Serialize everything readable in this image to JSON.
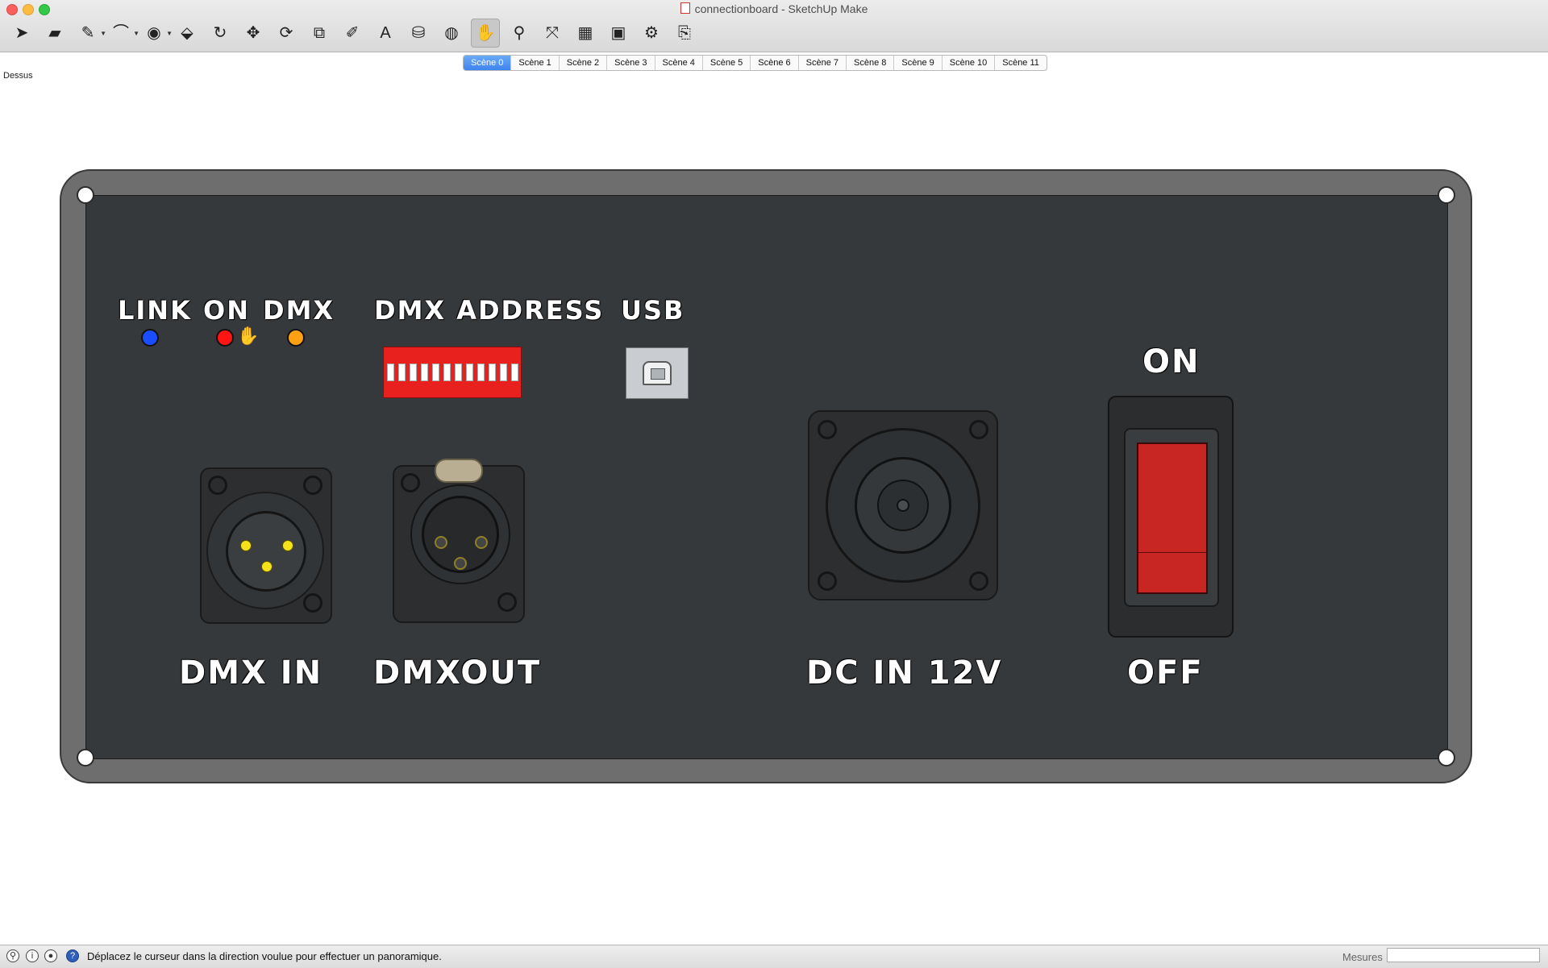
{
  "window": {
    "title": "connectionboard - SketchUp Make"
  },
  "toolbar": {
    "tools": [
      {
        "name": "select-tool",
        "glyph": "➤"
      },
      {
        "name": "eraser-tool",
        "glyph": "▰"
      },
      {
        "name": "pencil-tool",
        "glyph": "✎"
      },
      {
        "name": "arc-tool",
        "glyph": "⌒"
      },
      {
        "name": "shapes-tool",
        "glyph": "◉"
      },
      {
        "name": "push-pull-tool",
        "glyph": "⬙"
      },
      {
        "name": "follow-me-tool",
        "glyph": "↻"
      },
      {
        "name": "move-tool",
        "glyph": "✥"
      },
      {
        "name": "rotate-tool",
        "glyph": "⟳"
      },
      {
        "name": "scale-tool",
        "glyph": "⧉"
      },
      {
        "name": "tape-measure-tool",
        "glyph": "✐"
      },
      {
        "name": "text-tool",
        "glyph": "A"
      },
      {
        "name": "paint-bucket-tool",
        "glyph": "⛁"
      },
      {
        "name": "orbit-tool",
        "glyph": "◍"
      },
      {
        "name": "pan-tool",
        "glyph": "✋"
      },
      {
        "name": "zoom-tool",
        "glyph": "⚲"
      },
      {
        "name": "zoom-extents-tool",
        "glyph": "⤧"
      },
      {
        "name": "3d-warehouse-tool",
        "glyph": "▦"
      },
      {
        "name": "extension-warehouse-tool",
        "glyph": "▣"
      },
      {
        "name": "extension-manager-tool",
        "glyph": "⚙"
      },
      {
        "name": "send-to-layout-tool",
        "glyph": "⎘"
      }
    ],
    "active_tool": "pan-tool"
  },
  "scenes": {
    "tabs": [
      "Scène 0",
      "Scène 1",
      "Scène 2",
      "Scène 3",
      "Scène 4",
      "Scène 5",
      "Scène 6",
      "Scène 7",
      "Scène 8",
      "Scène 9",
      "Scène 10",
      "Scène 11"
    ],
    "active_index": 0
  },
  "view": {
    "label": "Dessus"
  },
  "model": {
    "labels": {
      "link": "LINK",
      "on_led": "ON",
      "dmx_led": "DMX",
      "dmx_address": "DMX ADDRESS",
      "usb": "USB",
      "switch_on": "ON",
      "switch_off": "OFF",
      "dmx_in": "DMX IN",
      "dmx_out": "DMXOUT",
      "dc_in": "DC IN 12V"
    },
    "led_colors": {
      "link": "#1a4dff",
      "on": "#ff1414",
      "dmx": "#ffa012"
    },
    "dip_switch_count": 12
  },
  "statusbar": {
    "message": "Déplacez le curseur dans la direction voulue pour effectuer un panoramique.",
    "measure_label": "Mesures",
    "measure_value": ""
  }
}
